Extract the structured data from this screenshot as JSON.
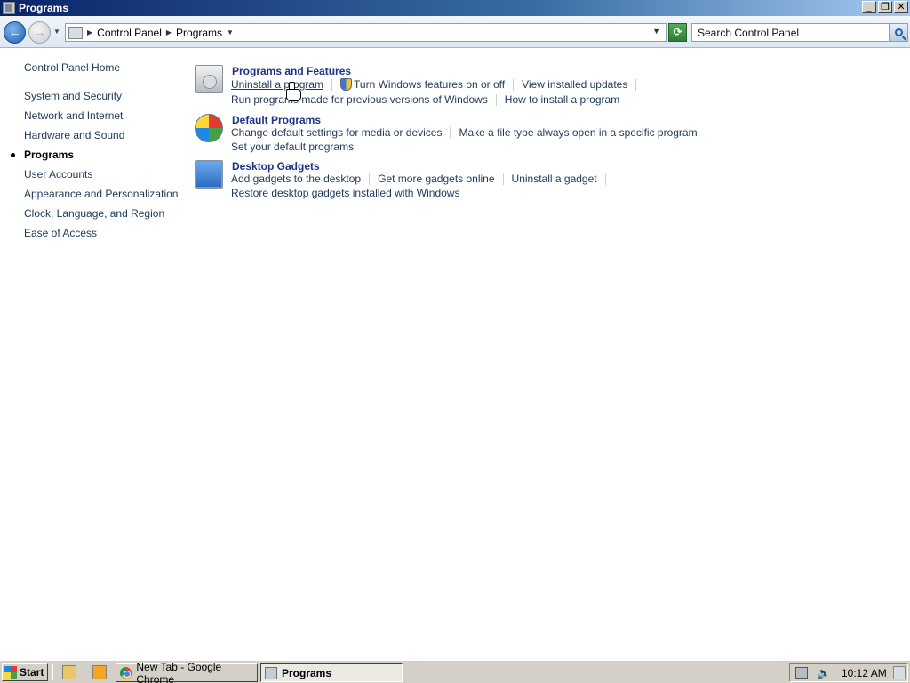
{
  "window": {
    "title": "Programs",
    "controls": [
      "minimize",
      "restore",
      "close"
    ]
  },
  "address_bar": {
    "crumbs": [
      "Control Panel",
      "Programs"
    ],
    "search_placeholder": "Search Control Panel",
    "refresh_icon": "refresh-icon",
    "search_icon": "magnifier-icon"
  },
  "sidebar": {
    "home": "Control Panel Home",
    "items": [
      {
        "label": "System and Security"
      },
      {
        "label": "Network and Internet"
      },
      {
        "label": "Hardware and Sound"
      },
      {
        "label": "Programs",
        "active": true
      },
      {
        "label": "User Accounts"
      },
      {
        "label": "Appearance and Personalization"
      },
      {
        "label": "Clock, Language, and Region"
      },
      {
        "label": "Ease of Access"
      }
    ]
  },
  "sections": [
    {
      "title": "Programs and Features",
      "icon": "programs-features-icon",
      "links": [
        "Uninstall a program",
        "Turn Windows features on or off",
        "View installed updates",
        "Run programs made for previous versions of Windows",
        "How to install a program"
      ]
    },
    {
      "title": "Default Programs",
      "icon": "default-programs-icon",
      "links": [
        "Change default settings for media or devices",
        "Make a file type always open in a specific program",
        "Set your default programs"
      ]
    },
    {
      "title": "Desktop Gadgets",
      "icon": "desktop-gadgets-icon",
      "links": [
        "Add gadgets to the desktop",
        "Get more gadgets online",
        "Uninstall a gadget",
        "Restore desktop gadgets installed with Windows"
      ]
    }
  ],
  "taskbar": {
    "start": "Start",
    "tasks": [
      {
        "label": "New Tab - Google Chrome",
        "icon": "chrome-icon",
        "active": false
      },
      {
        "label": "Programs",
        "icon": "control-panel-icon",
        "active": true
      }
    ],
    "clock": "10:12 AM"
  }
}
